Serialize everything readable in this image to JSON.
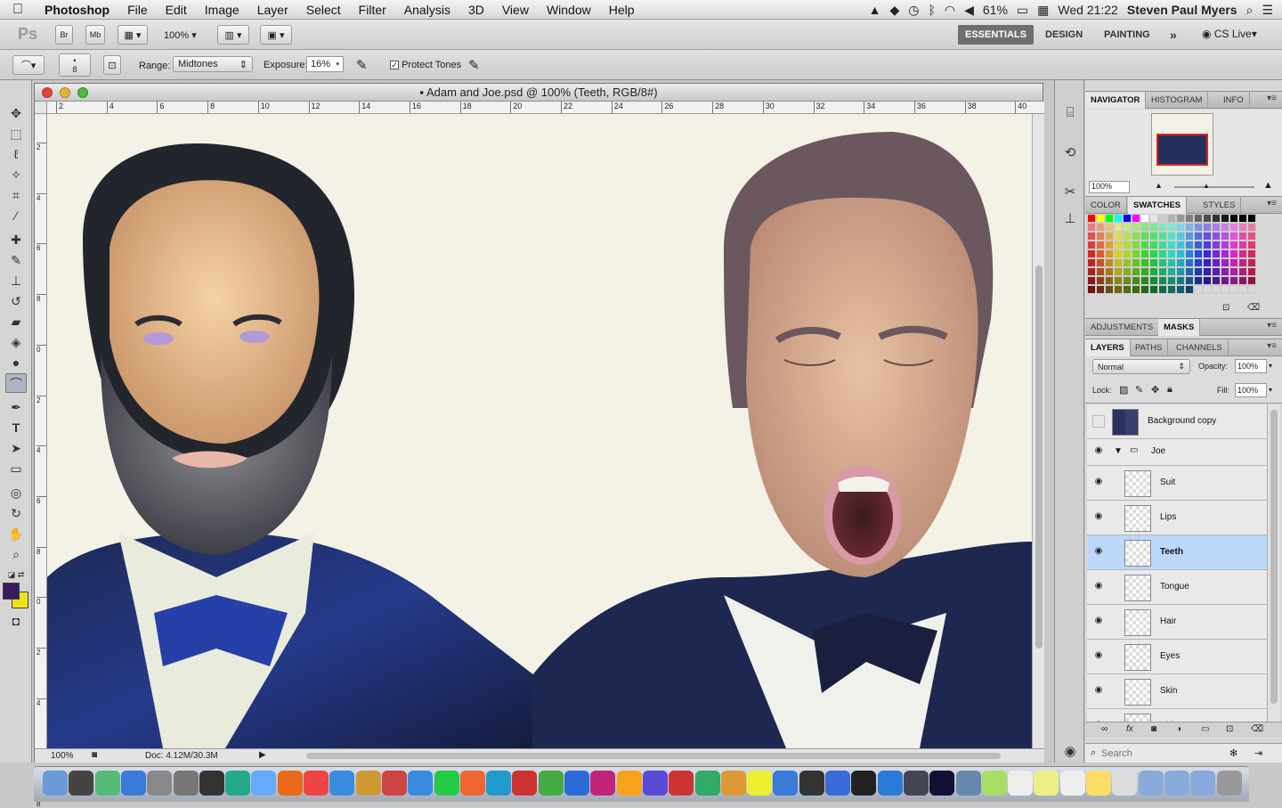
{
  "menubar": {
    "apple": "",
    "app": "Photoshop",
    "items": [
      "File",
      "Edit",
      "Image",
      "Layer",
      "Select",
      "Filter",
      "Analysis",
      "3D",
      "View",
      "Window",
      "Help"
    ],
    "battery": "61%",
    "clock": "Wed 21:22",
    "user": "Steven Paul Myers"
  },
  "appbar": {
    "ps_logo": "Ps",
    "br": "Br",
    "mb": "Mb",
    "zoom": "100%",
    "workspaces": [
      "ESSENTIALS",
      "DESIGN",
      "PAINTING"
    ],
    "more": "»",
    "cslive": "CS Live"
  },
  "options": {
    "brush_size": "8",
    "range_label": "Range:",
    "range_value": "Midtones",
    "exposure_label": "Exposure:",
    "exposure_value": "16%",
    "protect_tones": "Protect Tones"
  },
  "document": {
    "title": "Adam and Joe.psd @ 100% (Teeth, RGB/8#)",
    "ruler_h": [
      "2",
      "4",
      "6",
      "8",
      "10",
      "12",
      "14",
      "16",
      "18",
      "20",
      "22",
      "24",
      "26",
      "28",
      "30",
      "32",
      "34",
      "36",
      "38",
      "40"
    ],
    "ruler_v": [
      "2",
      "4",
      "6",
      "8",
      "0",
      "2",
      "4",
      "6",
      "8",
      "0",
      "2",
      "4",
      "6",
      "8"
    ],
    "status_zoom": "100%",
    "status_doc": "Doc: 4.12M/30.3M"
  },
  "navigator": {
    "tabs": [
      "NAVIGATOR",
      "HISTOGRAM",
      "INFO"
    ],
    "zoom": "100%"
  },
  "color_panel": {
    "tabs": [
      "COLOR",
      "SWATCHES",
      "STYLES"
    ]
  },
  "adjust_panel": {
    "tabs": [
      "ADJUSTMENTS",
      "MASKS"
    ]
  },
  "layers_panel": {
    "tabs": [
      "LAYERS",
      "PATHS",
      "CHANNELS"
    ],
    "blend_mode": "Normal",
    "opacity_label": "Opacity:",
    "opacity": "100%",
    "lock_label": "Lock:",
    "fill_label": "Fill:",
    "fill": "100%",
    "layers": [
      {
        "name": "Background copy",
        "visible": false,
        "group": false,
        "indent": false,
        "selected": false
      },
      {
        "name": "Joe",
        "visible": true,
        "group": true,
        "indent": false,
        "selected": false
      },
      {
        "name": "Suit",
        "visible": true,
        "group": false,
        "indent": true,
        "selected": false
      },
      {
        "name": "Lips",
        "visible": true,
        "group": false,
        "indent": true,
        "selected": false
      },
      {
        "name": "Teeth",
        "visible": true,
        "group": false,
        "indent": true,
        "selected": true
      },
      {
        "name": "Tongue",
        "visible": true,
        "group": false,
        "indent": true,
        "selected": false
      },
      {
        "name": "Hair",
        "visible": true,
        "group": false,
        "indent": true,
        "selected": false
      },
      {
        "name": "Eyes",
        "visible": true,
        "group": false,
        "indent": true,
        "selected": false
      },
      {
        "name": "Skin",
        "visible": true,
        "group": false,
        "indent": true,
        "selected": false
      },
      {
        "name": "Shirt",
        "visible": true,
        "group": false,
        "indent": true,
        "selected": false
      }
    ]
  },
  "search": {
    "placeholder": "Search"
  },
  "colors": {
    "foreground": "#3a1a5e",
    "background": "#f2e11a",
    "selection": "#bcd8fb",
    "canvas": "#f4f1e6"
  }
}
